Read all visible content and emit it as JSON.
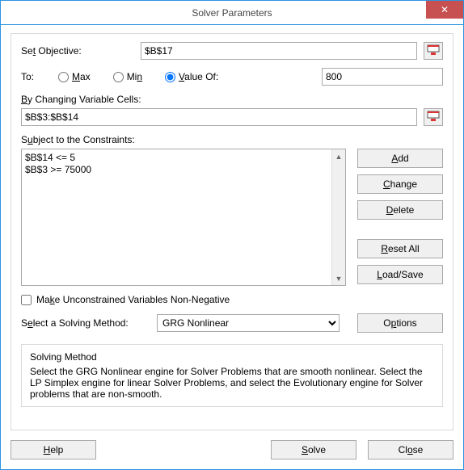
{
  "window": {
    "title": "Solver Parameters",
    "close": "✕"
  },
  "labels": {
    "set_objective": "Set Objective:",
    "to": "To:",
    "max": "Max",
    "min": "Min",
    "value_of": "Value Of:",
    "by_changing": "By Changing Variable Cells:",
    "subject_to": "Subject to the Constraints:",
    "make_unconstrained": "Make Unconstrained Variables Non-Negative",
    "select_method": "Select a Solving Method:"
  },
  "fields": {
    "objective": "$B$17",
    "value_of": "800",
    "changing_cells": "$B$3:$B$14",
    "method_selected": "GRG Nonlinear",
    "to_selected": "value_of",
    "make_unconstrained_checked": false
  },
  "constraints": [
    "$B$14 <= 5",
    "$B$3 >= 75000"
  ],
  "buttons": {
    "add": "Add",
    "change": "Change",
    "delete": "Delete",
    "reset_all": "Reset All",
    "load_save": "Load/Save",
    "options": "Options",
    "help": "Help",
    "solve": "Solve",
    "close": "Close"
  },
  "method_box": {
    "title": "Solving Method",
    "body": "Select the GRG Nonlinear engine for Solver Problems that are smooth nonlinear. Select the LP Simplex engine for linear Solver Problems, and select the Evolutionary engine for Solver problems that are non-smooth."
  }
}
